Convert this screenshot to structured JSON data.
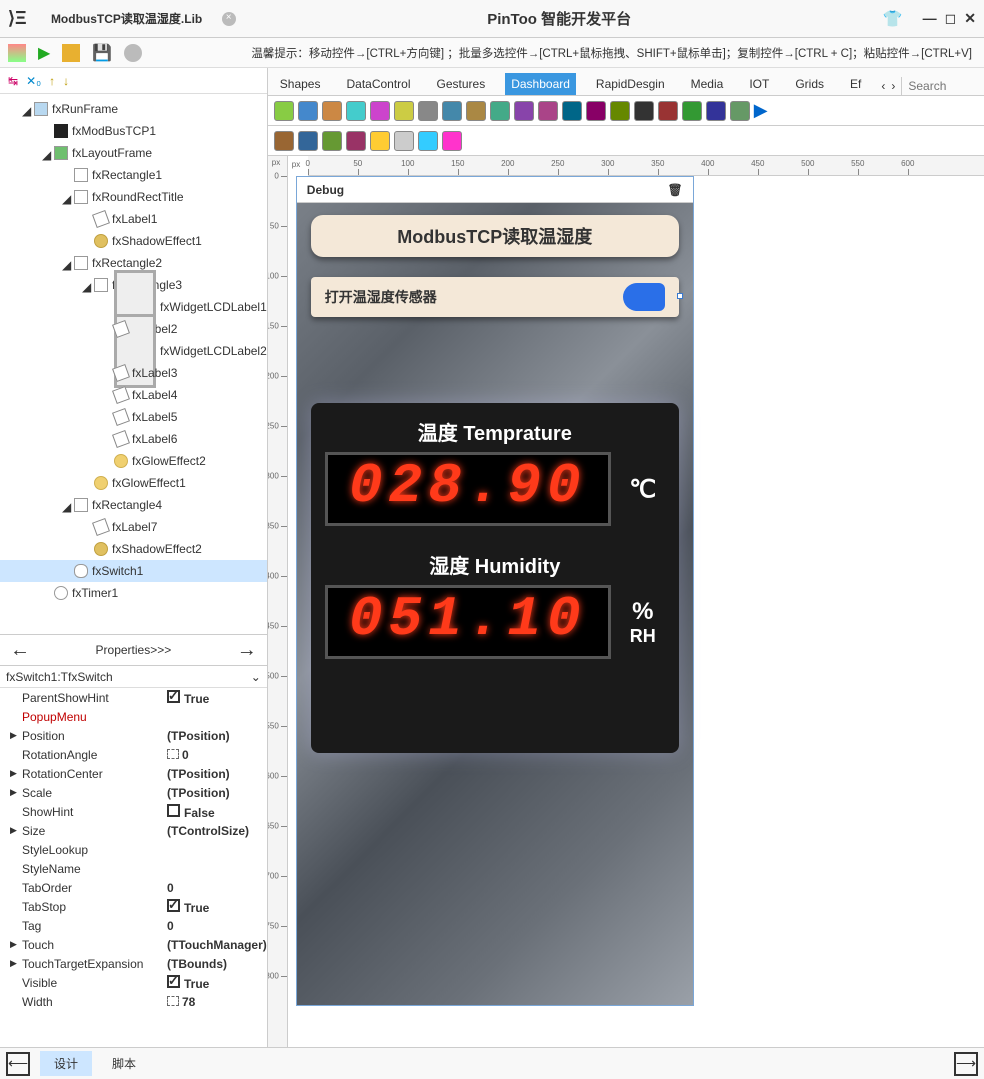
{
  "title_tab": "ModbusTCP读取温湿度.Lib",
  "app_title": "PinToo 智能开发平台",
  "hint": "温馨提示：移动控件→[CTRL+方向键] ；批量多选控件→[CTRL+鼠标拖拽、SHIFT+鼠标单击]；复制控件→[CTRL + C]；粘贴控件→[CTRL+V]",
  "tree": [
    {
      "d": 0,
      "i": "frame",
      "t": "fxRunFrame",
      "c": 1
    },
    {
      "d": 1,
      "i": "tcp",
      "t": "fxModBusTCP1",
      "c": 0
    },
    {
      "d": 1,
      "i": "layout",
      "t": "fxLayoutFrame",
      "c": 1
    },
    {
      "d": 2,
      "i": "rect",
      "t": "fxRectangle1",
      "c": 0
    },
    {
      "d": 2,
      "i": "rect",
      "t": "fxRoundRectTitle",
      "c": 1
    },
    {
      "d": 3,
      "i": "label",
      "t": "fxLabel1",
      "c": 0
    },
    {
      "d": 3,
      "i": "shadow",
      "t": "fxShadowEffect1",
      "c": 0
    },
    {
      "d": 2,
      "i": "rect",
      "t": "fxRectangle2",
      "c": 1
    },
    {
      "d": 3,
      "i": "rect",
      "t": "fxRectangle3",
      "c": 1
    },
    {
      "d": 4,
      "i": "lcd",
      "t": "fxWidgetLCDLabel1",
      "c": 0
    },
    {
      "d": 4,
      "i": "label",
      "t": "fxLabel2",
      "c": 0
    },
    {
      "d": 4,
      "i": "lcd",
      "t": "fxWidgetLCDLabel2",
      "c": 0
    },
    {
      "d": 4,
      "i": "label",
      "t": "fxLabel3",
      "c": 0
    },
    {
      "d": 4,
      "i": "label",
      "t": "fxLabel4",
      "c": 0
    },
    {
      "d": 4,
      "i": "label",
      "t": "fxLabel5",
      "c": 0
    },
    {
      "d": 4,
      "i": "label",
      "t": "fxLabel6",
      "c": 0
    },
    {
      "d": 4,
      "i": "glow",
      "t": "fxGlowEffect2",
      "c": 0
    },
    {
      "d": 3,
      "i": "glow",
      "t": "fxGlowEffect1",
      "c": 0
    },
    {
      "d": 2,
      "i": "rect",
      "t": "fxRectangle4",
      "c": 1
    },
    {
      "d": 3,
      "i": "label",
      "t": "fxLabel7",
      "c": 0
    },
    {
      "d": 3,
      "i": "shadow",
      "t": "fxShadowEffect2",
      "c": 0
    },
    {
      "d": 2,
      "i": "switch",
      "t": "fxSwitch1",
      "c": 0,
      "sel": 1
    },
    {
      "d": 1,
      "i": "timer",
      "t": "fxTimer1",
      "c": 0
    }
  ],
  "prop_header": "Properties>>>",
  "prop_selector": "fxSwitch1:TfxSwitch",
  "props": [
    {
      "n": "ParentShowHint",
      "v": "True",
      "chk": 1
    },
    {
      "n": "PopupMenu",
      "v": "",
      "red": 1
    },
    {
      "n": "Position",
      "v": "(TPosition)",
      "exp": 1
    },
    {
      "n": "RotationAngle",
      "v": "0",
      "ico": 1
    },
    {
      "n": "RotationCenter",
      "v": "(TPosition)",
      "exp": 1
    },
    {
      "n": "Scale",
      "v": "(TPosition)",
      "exp": 1
    },
    {
      "n": "ShowHint",
      "v": "False",
      "chk": 0,
      "box": 1
    },
    {
      "n": "Size",
      "v": "(TControlSize)",
      "exp": 1
    },
    {
      "n": "StyleLookup",
      "v": ""
    },
    {
      "n": "StyleName",
      "v": ""
    },
    {
      "n": "TabOrder",
      "v": "0"
    },
    {
      "n": "TabStop",
      "v": "True",
      "chk": 1
    },
    {
      "n": "Tag",
      "v": "0"
    },
    {
      "n": "Touch",
      "v": "(TTouchManager)",
      "exp": 1
    },
    {
      "n": "TouchTargetExpansion",
      "v": "(TBounds)",
      "exp": 1
    },
    {
      "n": "Visible",
      "v": "True",
      "chk": 1
    },
    {
      "n": "Width",
      "v": "78",
      "ico": 1
    }
  ],
  "tabs": [
    "Shapes",
    "DataControl",
    "Gestures",
    "Dashboard",
    "RapidDesgin",
    "Media",
    "IOT",
    "Grids",
    "Ef"
  ],
  "active_tab": 3,
  "search_placeholder": "Search",
  "debug_label": "Debug",
  "device": {
    "title": "ModbusTCP读取温湿度",
    "switch_label": "打开温湿度传感器",
    "temp_label": "温度 Temprature",
    "temp_value": "028.90",
    "temp_unit": "℃",
    "hum_label": "湿度 Humidity",
    "hum_value": "051.10",
    "hum_unit1": "%",
    "hum_unit2": "RH"
  },
  "footer": {
    "tab1": "设计",
    "tab2": "脚本"
  },
  "ruler_h": [
    350,
    400,
    450,
    500,
    550,
    600
  ],
  "ruler_v": [
    0,
    50,
    100,
    150,
    200,
    250,
    300,
    350,
    400,
    450,
    500,
    550,
    600,
    650,
    700,
    750,
    800
  ]
}
